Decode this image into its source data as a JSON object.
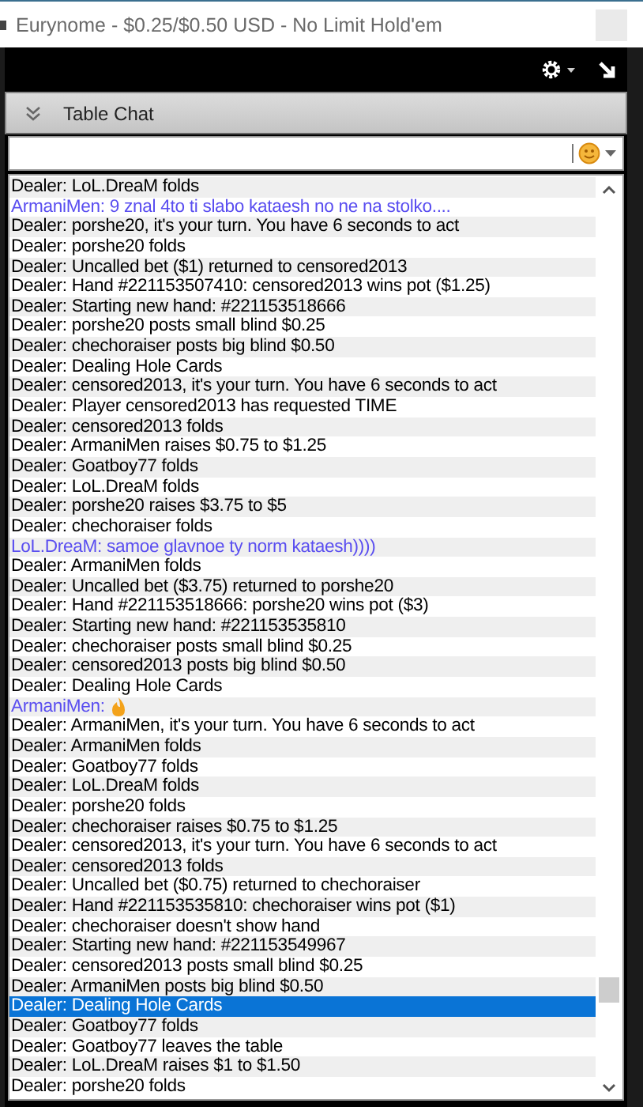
{
  "window": {
    "title": "Eurynome - $0.25/$0.50 USD - No Limit Hold'em"
  },
  "panel": {
    "title": "Table Chat",
    "expanded": true
  },
  "messages": [
    {
      "kind": "dealer",
      "text": "Dealer: LoL.DreaM folds",
      "selected": false
    },
    {
      "kind": "chat",
      "text": "ArmaniMen: 9 znal 4to ti slabo kataesh no ne na stolko....",
      "selected": false
    },
    {
      "kind": "dealer",
      "text": "Dealer: porshe20, it's your turn. You have 6 seconds to act",
      "selected": false
    },
    {
      "kind": "dealer",
      "text": "Dealer: porshe20 folds",
      "selected": false
    },
    {
      "kind": "dealer",
      "text": "Dealer: Uncalled bet ($1) returned to censored2013",
      "selected": false
    },
    {
      "kind": "dealer",
      "text": "Dealer: Hand #221153507410: censored2013 wins pot ($1.25)",
      "selected": false
    },
    {
      "kind": "dealer",
      "text": "Dealer: Starting new hand: #221153518666",
      "selected": false
    },
    {
      "kind": "dealer",
      "text": "Dealer: porshe20 posts small blind $0.25",
      "selected": false
    },
    {
      "kind": "dealer",
      "text": "Dealer: chechoraiser posts big blind $0.50",
      "selected": false
    },
    {
      "kind": "dealer",
      "text": "Dealer: Dealing Hole Cards",
      "selected": false
    },
    {
      "kind": "dealer",
      "text": "Dealer: censored2013, it's your turn. You have 6 seconds to act",
      "selected": false
    },
    {
      "kind": "dealer",
      "text": "Dealer: Player censored2013 has requested TIME",
      "selected": false
    },
    {
      "kind": "dealer",
      "text": "Dealer: censored2013 folds",
      "selected": false
    },
    {
      "kind": "dealer",
      "text": "Dealer: ArmaniMen raises $0.75 to $1.25",
      "selected": false
    },
    {
      "kind": "dealer",
      "text": "Dealer: Goatboy77 folds",
      "selected": false
    },
    {
      "kind": "dealer",
      "text": "Dealer: LoL.DreaM folds",
      "selected": false
    },
    {
      "kind": "dealer",
      "text": "Dealer: porshe20 raises $3.75 to $5",
      "selected": false
    },
    {
      "kind": "dealer",
      "text": "Dealer: chechoraiser folds",
      "selected": false
    },
    {
      "kind": "chat",
      "text": "LoL.DreaM: samoe glavnoe ty norm kataesh))))",
      "selected": false
    },
    {
      "kind": "dealer",
      "text": "Dealer: ArmaniMen folds",
      "selected": false
    },
    {
      "kind": "dealer",
      "text": "Dealer: Uncalled bet ($3.75) returned to porshe20",
      "selected": false
    },
    {
      "kind": "dealer",
      "text": "Dealer: Hand #221153518666: porshe20 wins pot ($3)",
      "selected": false
    },
    {
      "kind": "dealer",
      "text": "Dealer: Starting new hand: #221153535810",
      "selected": false
    },
    {
      "kind": "dealer",
      "text": "Dealer: chechoraiser posts small blind $0.25",
      "selected": false
    },
    {
      "kind": "dealer",
      "text": "Dealer: censored2013 posts big blind $0.50",
      "selected": false
    },
    {
      "kind": "dealer",
      "text": "Dealer: Dealing Hole Cards",
      "selected": false
    },
    {
      "kind": "emoji",
      "text": "ArmaniMen:",
      "selected": false
    },
    {
      "kind": "dealer",
      "text": "Dealer: ArmaniMen, it's your turn. You have 6 seconds to act",
      "selected": false
    },
    {
      "kind": "dealer",
      "text": "Dealer: ArmaniMen folds",
      "selected": false
    },
    {
      "kind": "dealer",
      "text": "Dealer: Goatboy77 folds",
      "selected": false
    },
    {
      "kind": "dealer",
      "text": "Dealer: LoL.DreaM folds",
      "selected": false
    },
    {
      "kind": "dealer",
      "text": "Dealer: porshe20 folds",
      "selected": false
    },
    {
      "kind": "dealer",
      "text": "Dealer: chechoraiser raises $0.75 to $1.25",
      "selected": false
    },
    {
      "kind": "dealer",
      "text": "Dealer: censored2013, it's your turn. You have 6 seconds to act",
      "selected": false
    },
    {
      "kind": "dealer",
      "text": "Dealer: censored2013 folds",
      "selected": false
    },
    {
      "kind": "dealer",
      "text": "Dealer: Uncalled bet ($0.75) returned to chechoraiser",
      "selected": false
    },
    {
      "kind": "dealer",
      "text": "Dealer: Hand #221153535810: chechoraiser wins pot ($1)",
      "selected": false
    },
    {
      "kind": "dealer",
      "text": "Dealer: chechoraiser doesn't show hand",
      "selected": false
    },
    {
      "kind": "dealer",
      "text": "Dealer: Starting new hand: #221153549967",
      "selected": false
    },
    {
      "kind": "dealer",
      "text": "Dealer: censored2013 posts small blind $0.25",
      "selected": false
    },
    {
      "kind": "dealer",
      "text": "Dealer: ArmaniMen posts big blind $0.50",
      "selected": false
    },
    {
      "kind": "dealer",
      "text": "Dealer: Dealing Hole Cards",
      "selected": true
    },
    {
      "kind": "dealer",
      "text": "Dealer: Goatboy77 folds",
      "selected": false
    },
    {
      "kind": "dealer",
      "text": "Dealer: Goatboy77 leaves the table",
      "selected": false
    },
    {
      "kind": "dealer",
      "text": "Dealer: LoL.DreaM raises $1 to $1.50",
      "selected": false
    },
    {
      "kind": "dealer",
      "text": "Dealer: porshe20 folds",
      "selected": false
    }
  ]
}
